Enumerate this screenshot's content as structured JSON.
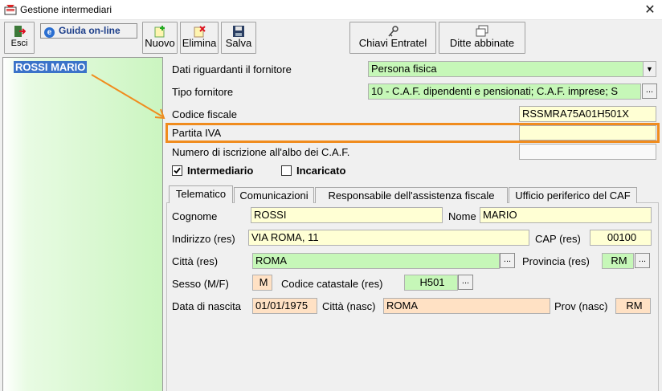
{
  "window": {
    "title": "Gestione intermediari",
    "close_glyph": "✕"
  },
  "toolbar": {
    "esci": "Esci",
    "guida": "Guida on-line",
    "nuovo": "Nuovo",
    "elimina": "Elimina",
    "salva": "Salva",
    "chiavi": "Chiavi Entratel",
    "ditte": "Ditte abbinate"
  },
  "left_list": {
    "items": [
      "ROSSI MARIO"
    ]
  },
  "fornitore": {
    "dati_label": "Dati riguardanti il fornitore",
    "dati_value": "Persona fisica",
    "tipo_label": "Tipo fornitore",
    "tipo_value": "10 - C.A.F. dipendenti e pensionati; C.A.F. imprese; S",
    "cf_label": "Codice fiscale",
    "cf_value": "RSSMRA75A01H501X",
    "piva_label": "Partita IVA",
    "piva_value": "",
    "albo_label": "Numero di iscrizione all'albo dei C.A.F.",
    "albo_value": ""
  },
  "checks": {
    "intermediario": "Intermediario",
    "intermediario_checked": true,
    "incaricato": "Incaricato",
    "incaricato_checked": false
  },
  "tabs": [
    "Telematico",
    "Comunicazioni",
    "Responsabile dell'assistenza fiscale",
    "Ufficio periferico del CAF"
  ],
  "telematico": {
    "cognome_label": "Cognome",
    "cognome_value": "ROSSI",
    "nome_label": "Nome",
    "nome_value": "MARIO",
    "indirizzo_label": "Indirizzo (res)",
    "indirizzo_value": "VIA ROMA, 11",
    "cap_label": "CAP (res)",
    "cap_value": "00100",
    "citta_label": "Città (res)",
    "citta_value": "ROMA",
    "provincia_label": "Provincia (res)",
    "provincia_value": "RM",
    "sesso_label": "Sesso (M/F)",
    "sesso_value": "M",
    "catastale_label": "Codice catastale (res)",
    "catastale_value": "H501",
    "nascita_label": "Data di nascita",
    "nascita_value": "01/01/1975",
    "citta_nasc_label": "Città (nasc)",
    "citta_nasc_value": "ROMA",
    "prov_nasc_label": "Prov (nasc)",
    "prov_nasc_value": "RM"
  },
  "colors": {
    "highlight": "#f08c1e",
    "field_green": "#c6f7b8",
    "field_yellow": "#ffffd4",
    "field_peach": "#ffe1c4"
  }
}
